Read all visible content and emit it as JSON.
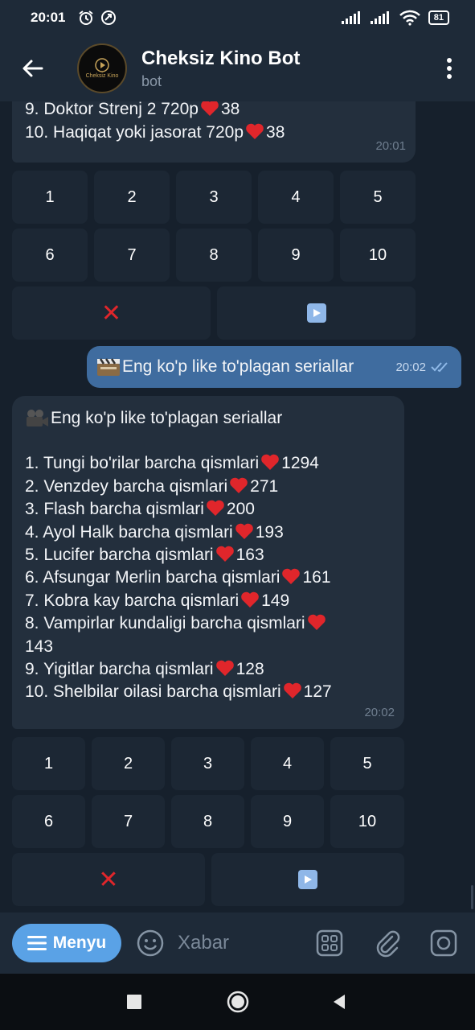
{
  "status_bar": {
    "time": "20:01",
    "battery": "81",
    "icons": [
      "alarm-icon",
      "app-notification-icon",
      "signal-icon",
      "signal-icon",
      "wifi-icon",
      "battery-icon"
    ]
  },
  "header": {
    "title": "Cheksiz Kino Bot",
    "subtitle": "bot",
    "avatar_text": "Cheksiz Kino"
  },
  "prev_message": {
    "partial_top": "10",
    "lines": [
      "9. Doktor Strenj 2 720p",
      "10. Haqiqat yoki jasorat 720p"
    ],
    "likes": [
      "38",
      "38"
    ],
    "time": "20:01"
  },
  "keyboard_1": {
    "row1": [
      "1",
      "2",
      "3",
      "4",
      "5"
    ],
    "row2": [
      "6",
      "7",
      "8",
      "9",
      "10"
    ],
    "close_icon": "red-cross-mark",
    "next_icon": "play-button"
  },
  "outgoing_message": {
    "emoji": "clapper-board",
    "text": "Eng ko'p like to'plagan seriallar",
    "time": "20:02",
    "status": "read-double-check"
  },
  "bot_message": {
    "emoji": "movie-camera",
    "title": "Eng ko'p like to'plagan seriallar",
    "items": [
      {
        "text": "1. Tungi bo'rilar barcha qismlari",
        "likes": "1294"
      },
      {
        "text": "2. Venzdey barcha qismlari",
        "likes": "271"
      },
      {
        "text": "3. Flash barcha qismlari",
        "likes": "200"
      },
      {
        "text": "4. Ayol Halk barcha qismlari",
        "likes": "193"
      },
      {
        "text": "5. Lucifer barcha qismlari",
        "likes": "163"
      },
      {
        "text": "6. Afsungar Merlin barcha qismlari",
        "likes": "161"
      },
      {
        "text": "7. Kobra kay barcha qismlari",
        "likes": "149"
      },
      {
        "text": "8. Vampirlar kundaligi barcha qismlari",
        "likes": "143"
      },
      {
        "text": "9. Yigitlar barcha qismlari",
        "likes": "128"
      },
      {
        "text": "10. Shelbilar oilasi barcha qismlari",
        "likes": "127"
      }
    ],
    "time": "20:02"
  },
  "keyboard_2": {
    "row1": [
      "1",
      "2",
      "3",
      "4",
      "5"
    ],
    "row2": [
      "6",
      "7",
      "8",
      "9",
      "10"
    ],
    "close_icon": "red-cross-mark",
    "next_icon": "play-button"
  },
  "input_bar": {
    "menu_label": "Menyu",
    "placeholder": "Xabar"
  },
  "colors": {
    "background": "#16202c",
    "bubble": "#232f3d",
    "outgoing_bubble": "#3f6c9f",
    "accent": "#5aa2e6",
    "heart": "#e0262b"
  }
}
